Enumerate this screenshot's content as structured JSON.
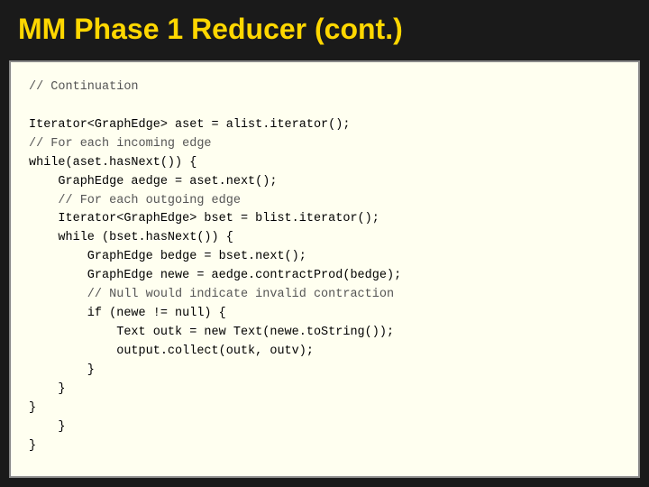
{
  "title": "MM Phase 1 Reducer (cont.)",
  "code": {
    "lines": [
      {
        "text": "// Continuation",
        "type": "comment"
      },
      {
        "text": "",
        "type": "blank"
      },
      {
        "text": "Iterator<GraphEdge> aset = alist.iterator();",
        "type": "code"
      },
      {
        "text": "// For each incoming edge",
        "type": "comment"
      },
      {
        "text": "while(aset.hasNext()) {",
        "type": "code"
      },
      {
        "text": "    GraphEdge aedge = aset.next();",
        "type": "code"
      },
      {
        "text": "    // For each outgoing edge",
        "type": "comment"
      },
      {
        "text": "    Iterator<GraphEdge> bset = blist.iterator();",
        "type": "code"
      },
      {
        "text": "    while (bset.hasNext()) {",
        "type": "code"
      },
      {
        "text": "        GraphEdge bedge = bset.next();",
        "type": "code"
      },
      {
        "text": "        GraphEdge newe = aedge.contractProd(bedge);",
        "type": "code"
      },
      {
        "text": "        // Null would indicate invalid contraction",
        "type": "comment"
      },
      {
        "text": "        if (newe != null) {",
        "type": "code"
      },
      {
        "text": "            Text outk = new Text(newe.toString());",
        "type": "code"
      },
      {
        "text": "            output.collect(outk, outv);",
        "type": "code"
      },
      {
        "text": "        }",
        "type": "code"
      },
      {
        "text": "    }",
        "type": "code"
      },
      {
        "text": "}",
        "type": "code"
      },
      {
        "text": "    }",
        "type": "code"
      },
      {
        "text": "}",
        "type": "code"
      }
    ]
  }
}
